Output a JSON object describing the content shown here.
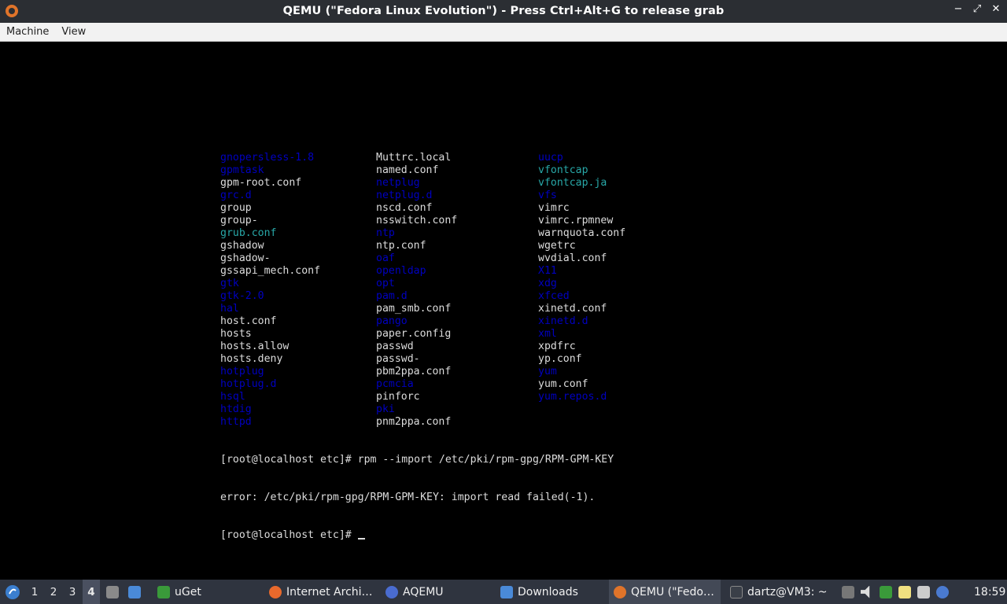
{
  "window": {
    "title": "QEMU (\"Fedora Linux Evolution\") - Press Ctrl+Alt+G to release grab",
    "minimize": "−",
    "maximize": "⤢",
    "close": "✕"
  },
  "menu": [
    "Machine",
    "View"
  ],
  "terminal": {
    "columns": [
      [
        {
          "text": "gnopersless-1.8",
          "c": "b"
        },
        {
          "text": "gpmtask",
          "c": "b"
        },
        {
          "text": "gpm-root.conf",
          "c": "w"
        },
        {
          "text": "grc.d",
          "c": "b"
        },
        {
          "text": "group",
          "c": "w"
        },
        {
          "text": "group-",
          "c": "w"
        },
        {
          "text": "grub.conf",
          "c": "t"
        },
        {
          "text": "gshadow",
          "c": "w"
        },
        {
          "text": "gshadow-",
          "c": "w"
        },
        {
          "text": "gssapi_mech.conf",
          "c": "w"
        },
        {
          "text": "gtk",
          "c": "b"
        },
        {
          "text": "gtk-2.0",
          "c": "b"
        },
        {
          "text": "hal",
          "c": "b"
        },
        {
          "text": "host.conf",
          "c": "w"
        },
        {
          "text": "hosts",
          "c": "w"
        },
        {
          "text": "hosts.allow",
          "c": "w"
        },
        {
          "text": "hosts.deny",
          "c": "w"
        },
        {
          "text": "hotplug",
          "c": "b"
        },
        {
          "text": "hotplug.d",
          "c": "b"
        },
        {
          "text": "hsql",
          "c": "b"
        },
        {
          "text": "htdig",
          "c": "b"
        },
        {
          "text": "httpd",
          "c": "b"
        }
      ],
      [
        {
          "text": "Muttrc.local",
          "c": "w"
        },
        {
          "text": "named.conf",
          "c": "w"
        },
        {
          "text": "netplug",
          "c": "b"
        },
        {
          "text": "netplug.d",
          "c": "b"
        },
        {
          "text": "nscd.conf",
          "c": "w"
        },
        {
          "text": "nsswitch.conf",
          "c": "w"
        },
        {
          "text": "ntp",
          "c": "b"
        },
        {
          "text": "ntp.conf",
          "c": "w"
        },
        {
          "text": "oaf",
          "c": "b"
        },
        {
          "text": "openldap",
          "c": "b"
        },
        {
          "text": "opt",
          "c": "b"
        },
        {
          "text": "pam.d",
          "c": "b"
        },
        {
          "text": "pam_smb.conf",
          "c": "w"
        },
        {
          "text": "pango",
          "c": "b"
        },
        {
          "text": "paper.config",
          "c": "w"
        },
        {
          "text": "passwd",
          "c": "w"
        },
        {
          "text": "passwd-",
          "c": "w"
        },
        {
          "text": "pbm2ppa.conf",
          "c": "w"
        },
        {
          "text": "pcmcia",
          "c": "b"
        },
        {
          "text": "pinforc",
          "c": "w"
        },
        {
          "text": "pki",
          "c": "b"
        },
        {
          "text": "pnm2ppa.conf",
          "c": "w"
        }
      ],
      [
        {
          "text": "uucp",
          "c": "b"
        },
        {
          "text": "vfontcap",
          "c": "t"
        },
        {
          "text": "vfontcap.ja",
          "c": "t"
        },
        {
          "text": "vfs",
          "c": "b"
        },
        {
          "text": "vimrc",
          "c": "w"
        },
        {
          "text": "vimrc.rpmnew",
          "c": "w"
        },
        {
          "text": "warnquota.conf",
          "c": "w"
        },
        {
          "text": "wgetrc",
          "c": "w"
        },
        {
          "text": "wvdial.conf",
          "c": "w"
        },
        {
          "text": "X11",
          "c": "b"
        },
        {
          "text": "xdg",
          "c": "b"
        },
        {
          "text": "xfced",
          "c": "b"
        },
        {
          "text": "xinetd.conf",
          "c": "w"
        },
        {
          "text": "xinetd.d",
          "c": "b"
        },
        {
          "text": "xml",
          "c": "b"
        },
        {
          "text": "xpdfrc",
          "c": "w"
        },
        {
          "text": "yp.conf",
          "c": "w"
        },
        {
          "text": "yum",
          "c": "b"
        },
        {
          "text": "yum.conf",
          "c": "w"
        },
        {
          "text": "yum.repos.d",
          "c": "b"
        }
      ]
    ],
    "cmd_line": "[root@localhost etc]# rpm --import /etc/pki/rpm-gpg/RPM-GPM-KEY",
    "error_line": "error: /etc/pki/rpm-gpg/RPM-GPM-KEY: import read failed(-1).",
    "prompt": "[root@localhost etc]# "
  },
  "taskbar": {
    "workspaces": [
      "1",
      "2",
      "3",
      "4"
    ],
    "active_workspace": "4",
    "tasks": [
      {
        "label": "uGet",
        "icon": "uget-icon",
        "color": "#3a9a3a"
      },
      {
        "label": "Internet Archi…",
        "icon": "firefox-icon",
        "color": "#e8692c"
      },
      {
        "label": "AQEMU",
        "icon": "aqemu-icon",
        "color": "#4a6cd0"
      },
      {
        "label": "Downloads",
        "icon": "folder-icon",
        "color": "#4a8ad8"
      },
      {
        "label": "QEMU (\"Fedo…",
        "icon": "qemu-icon",
        "color": "#e0742a"
      },
      {
        "label": "dartz@VM3: ~",
        "icon": "terminal-icon",
        "color": "#3a3f48"
      }
    ],
    "clock": "18:59"
  },
  "colors": {
    "titlebar": "#2b2e33",
    "taskbar": "#2f343f",
    "term_dir": "#0000c0",
    "term_link": "#28a8a8",
    "term_text": "#dcdcdc"
  }
}
